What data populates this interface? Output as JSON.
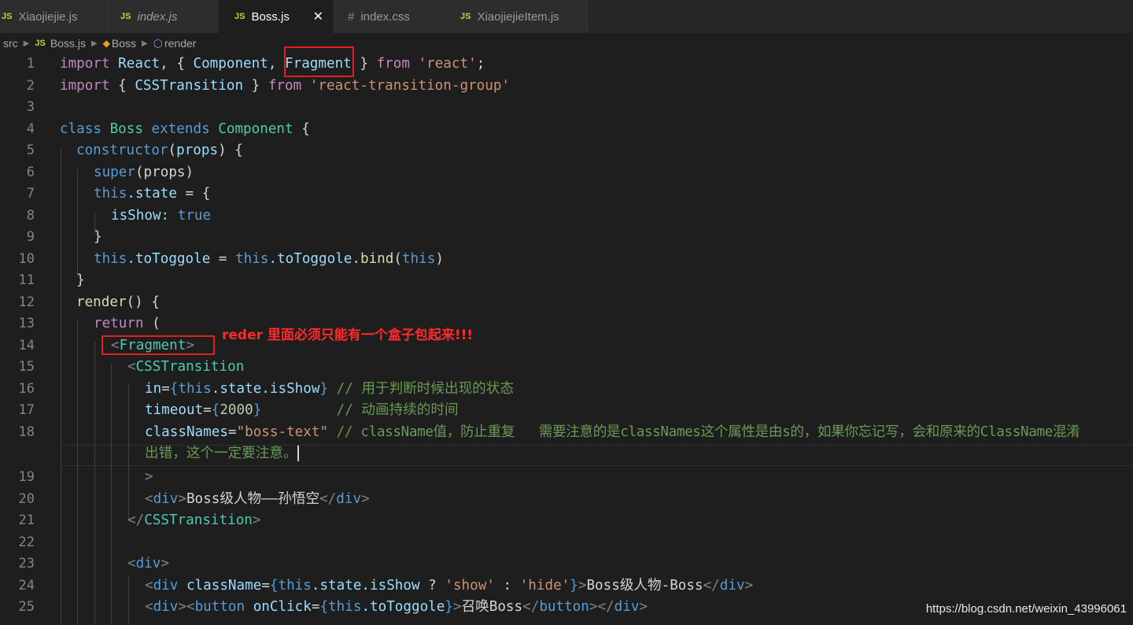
{
  "tabs": [
    {
      "label": "Xiaojiejie.js",
      "type": "JS",
      "italic": false,
      "active": false
    },
    {
      "label": "index.js",
      "type": "JS",
      "italic": true,
      "active": false
    },
    {
      "label": "Boss.js",
      "type": "JS",
      "italic": false,
      "active": true
    },
    {
      "label": "index.css",
      "type": "#",
      "italic": false,
      "active": false
    },
    {
      "label": "XiaojiejieItem.js",
      "type": "JS",
      "italic": false,
      "active": false
    }
  ],
  "close_glyph": "✕",
  "breadcrumb": {
    "folder": "src",
    "file_icon": "JS",
    "file": "Boss.js",
    "class": "Boss",
    "method": "render"
  },
  "line_numbers": [
    "1",
    "2",
    "3",
    "4",
    "5",
    "6",
    "7",
    "8",
    "9",
    "10",
    "11",
    "12",
    "13",
    "14",
    "15",
    "16",
    "17",
    "18",
    "19",
    "20",
    "21",
    "22",
    "23",
    "24",
    "25"
  ],
  "code": {
    "l1": {
      "import": "import",
      "react": "React,",
      "brace_open": "{",
      "component": "Component,",
      "fragment": "Fragment",
      "brace_close": "}",
      "from": "from",
      "module": "'react'",
      "semi": ";"
    },
    "l2": {
      "import": "import",
      "brace_open": "{",
      "css_transition": "CSSTransition",
      "brace_close": "}",
      "from": "from",
      "module": "'react-transition-group'"
    },
    "l4": {
      "class": "class",
      "boss": "Boss",
      "extends": "extends",
      "component": "Component",
      "brace": "{"
    },
    "l5": {
      "constructor": "constructor",
      "paren_open": "(",
      "props": "props",
      "paren_close": ")",
      "brace": "{"
    },
    "l6": {
      "super": "super",
      "args": "(props)"
    },
    "l7": {
      "this": "this",
      "rest": ".state",
      "assign": "= {"
    },
    "l8": {
      "key": "isShow:",
      "value": "true"
    },
    "l9": {
      "brace": "}"
    },
    "l10": {
      "this1": "this",
      "prop1": ".toToggole",
      "eq": "=",
      "this2": "this",
      "prop2": ".toToggole",
      "dot": ".",
      "bind": "bind",
      "paren_open": "(",
      "this3": "this",
      "paren_close": ")"
    },
    "l11": {
      "brace": "}"
    },
    "l12": {
      "render": "render",
      "rest": "() {"
    },
    "l13": {
      "return": "return",
      "paren": "("
    },
    "l14": {
      "lt": "<",
      "tag": "Fragment",
      "gt": ">"
    },
    "l15": {
      "lt": "<",
      "tag": "CSSTransition"
    },
    "l16": {
      "attr": "in",
      "eq": "=",
      "brace_open": "{",
      "this": "this",
      "path": ".state.isShow",
      "brace_close": "}",
      "comment": "// 用于判断时候出现的状态"
    },
    "l17": {
      "attr": "timeout",
      "eq": "=",
      "brace_open": "{",
      "value": "2000",
      "brace_close": "}",
      "comment": "// 动画持续的时间"
    },
    "l18": {
      "attr": "classNames",
      "eq": "=",
      "value": "\"boss-text\"",
      "comment": "// className值，防止重复   需要注意的是classNames这个属性是由s的，如果你忘记写，会和原来的ClassName混淆",
      "comment_wrap": "出错，这个一定要注意。"
    },
    "l19": {
      "gt": ">"
    },
    "l20": {
      "open": "<",
      "tag": "div",
      "open_end": ">",
      "text": "Boss级人物——孙悟空",
      "close": "</",
      "close_tag": "div",
      "close_end": ">"
    },
    "l21": {
      "close": "</",
      "tag": "CSSTransition",
      "end": ">"
    },
    "l23": {
      "open": "<",
      "tag": "div",
      "end": ">"
    },
    "l24": {
      "open": "<",
      "tag": "div",
      "attr": "className",
      "eq": "=",
      "brace_open": "{",
      "this": "this",
      "path": ".state.isShow",
      "q": "?",
      "show": "'show'",
      "colon": ":",
      "hide": "'hide'",
      "brace_close": "}",
      "gt": ">",
      "text": "Boss级人物-Boss",
      "close": "</",
      "close_tag": "div",
      "close_end": ">"
    },
    "l25": {
      "open": "<",
      "tag": "div",
      "gt": ">",
      "open2": "<",
      "tag2": "button",
      "attr": "onClick",
      "eq": "=",
      "brace_open": "{",
      "this": "this",
      "path": ".toToggole",
      "brace_close": "}",
      "gt2": ">",
      "text": "召唤Boss",
      "close": "</",
      "close_tag": "button",
      "close_end": ">",
      "close2": "</",
      "close_tag2": "div",
      "close_end2": ">"
    }
  },
  "annotation": "reder 里面必须只能有一个盒子包起来!!!",
  "watermark": "https://blog.csdn.net/weixin_43996061",
  "colors": {
    "keyword": "#c586c0",
    "storage": "#569cd6",
    "type": "#4ec9b0",
    "variable": "#9cdcfe",
    "string": "#ce9178",
    "function": "#dcdcaa",
    "comment": "#6a9955",
    "number": "#b5cea8",
    "annotation": "#ff2a2a"
  }
}
